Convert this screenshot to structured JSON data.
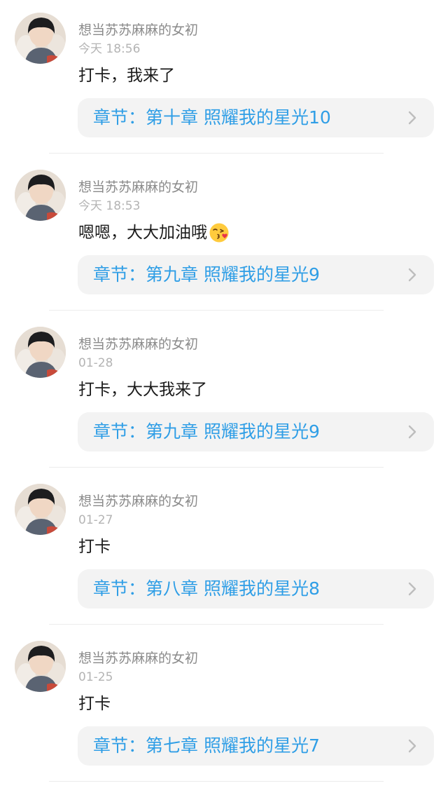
{
  "colors": {
    "username": "#8a8a8a",
    "time": "#b4b4b4",
    "content": "#1a1a1a",
    "chapter_link": "#2f9ee6",
    "chapter_bg": "#f3f3f3"
  },
  "comments": [
    {
      "username": "想当苏苏麻麻的女初",
      "time": "今天 18:56",
      "content": "打卡，我来了",
      "chapter": "章节：第十章 照耀我的星光10"
    },
    {
      "username": "想当苏苏麻麻的女初",
      "time": "今天 18:53",
      "content": "嗯嗯，大大加油哦",
      "emoji": "kissing-face-emoji",
      "chapter": "章节：第九章 照耀我的星光9"
    },
    {
      "username": "想当苏苏麻麻的女初",
      "time": "01-28",
      "content": "打卡，大大我来了",
      "chapter": "章节：第九章 照耀我的星光9"
    },
    {
      "username": "想当苏苏麻麻的女初",
      "time": "01-27",
      "content": "打卡",
      "chapter": "章节：第八章 照耀我的星光8"
    },
    {
      "username": "想当苏苏麻麻的女初",
      "time": "01-25",
      "content": "打卡",
      "chapter": "章节：第七章 照耀我的星光7"
    }
  ]
}
